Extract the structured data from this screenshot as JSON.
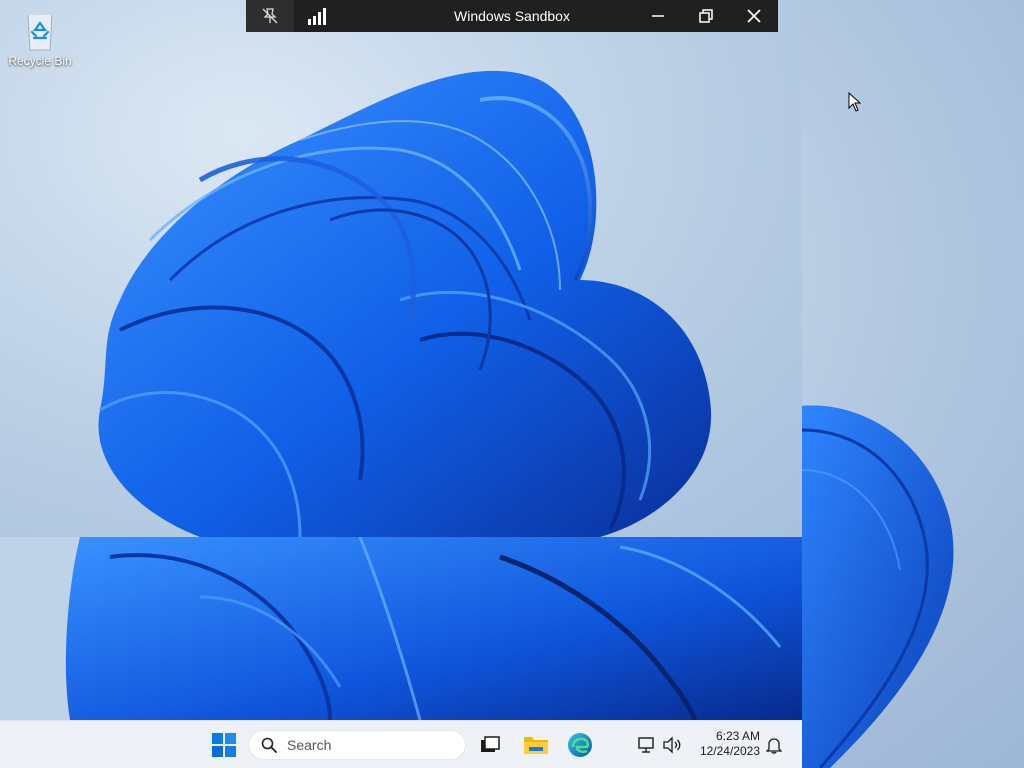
{
  "window": {
    "title": "Windows Sandbox"
  },
  "desktop": {
    "icons": [
      {
        "label": "Recycle Bin",
        "icon": "recycle-bin-icon"
      }
    ]
  },
  "titlebar": {
    "pin_icon": "pin-off-icon",
    "connection_icon": "signal-bars-icon",
    "buttons": [
      "minimize-icon",
      "restore-icon",
      "close-icon"
    ]
  },
  "taskbar": {
    "search_placeholder": "Search",
    "apps": [
      "windows-start-icon",
      "task-view-icon",
      "file-explorer-icon",
      "edge-icon"
    ],
    "tray": {
      "network_icon": "network-icon",
      "volume_icon": "volume-icon",
      "time": "6:23 AM",
      "date": "12/24/2023",
      "notification_icon": "bell-icon"
    }
  },
  "colors": {
    "accent_blue": "#0a5fe0",
    "titlebar_bg": "#202020",
    "taskbar_bg": "#eef1f6"
  }
}
